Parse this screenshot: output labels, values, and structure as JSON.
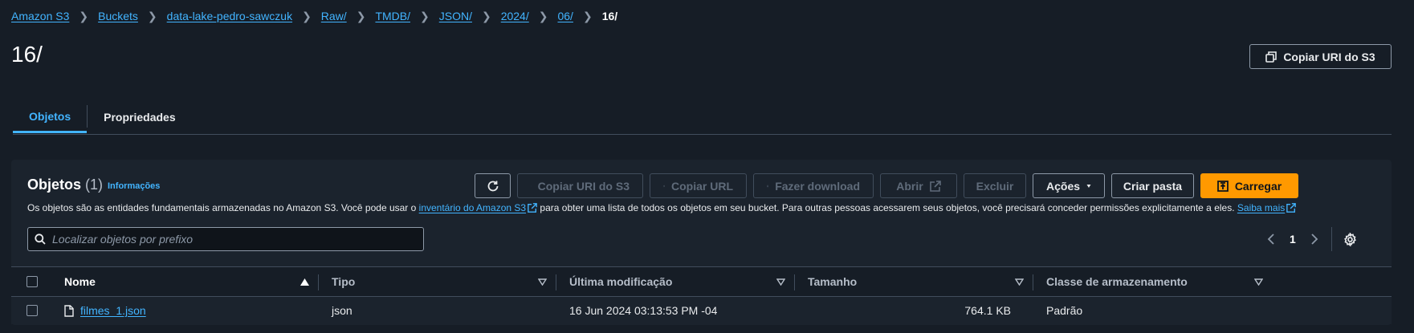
{
  "breadcrumb": {
    "items": [
      "Amazon S3",
      "Buckets",
      "data-lake-pedro-sawczuk",
      "Raw/",
      "TMDB/",
      "JSON/",
      "2024/",
      "06/"
    ],
    "current": "16/"
  },
  "page": {
    "title": "16/",
    "copy_uri_label": "Copiar URI do S3"
  },
  "tabs": [
    {
      "label": "Objetos",
      "active": true
    },
    {
      "label": "Propriedades",
      "active": false
    }
  ],
  "objects_panel": {
    "title": "Objetos",
    "count": "(1)",
    "info_link": "Informações",
    "description_part1": "Os objetos são as entidades fundamentais armazenadas no Amazon S3. Você pode usar o",
    "description_link1": "inventário do Amazon S3",
    "description_part2": "para obter uma lista de todos os objetos em seu bucket. Para outras pessoas acessarem seus objetos, você precisará conceder permissões explicitamente a eles.",
    "description_link2": "Saiba mais",
    "toolbar": {
      "copy_uri": "Copiar URI do S3",
      "copy_url": "Copiar URL",
      "download": "Fazer download",
      "open": "Abrir",
      "delete": "Excluir",
      "actions": "Ações",
      "create_folder": "Criar pasta",
      "upload": "Carregar"
    },
    "search": {
      "placeholder": "Localizar objetos por prefixo",
      "value": ""
    },
    "pagination": {
      "page": "1"
    }
  },
  "table": {
    "columns": [
      "Nome",
      "Tipo",
      "Última modificação",
      "Tamanho",
      "Classe de armazenamento"
    ],
    "rows": [
      {
        "name": "filmes_1.json",
        "type": "json",
        "last_modified": "16 Jun 2024 03:13:53 PM -04",
        "size": "764.1 KB",
        "storage_class": "Padrão"
      }
    ]
  },
  "colors": {
    "accent": "#42b4ff",
    "primary_button": "#ff9900",
    "background": "#161d26"
  }
}
